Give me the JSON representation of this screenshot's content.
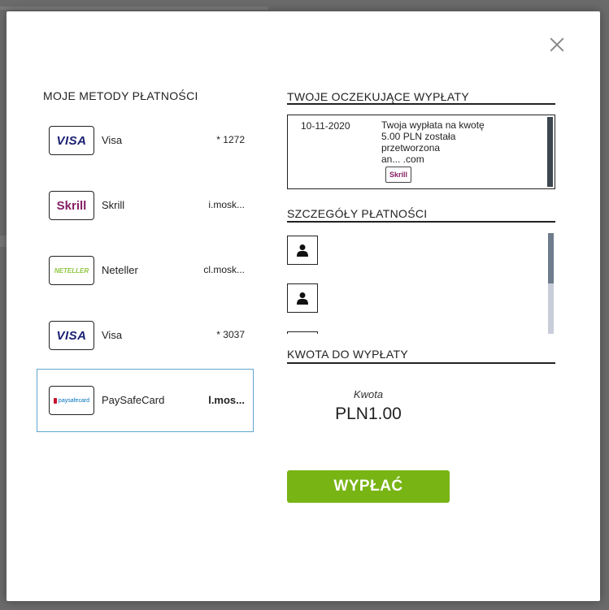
{
  "close": {
    "icon": "close-icon"
  },
  "methods": {
    "title": "MOJE METODY PŁATNOŚCI",
    "items": [
      {
        "name": "Visa",
        "id": "* 1272",
        "logo": "VISA",
        "icon": "visa-logo"
      },
      {
        "name": "Skrill",
        "id": "i.mosk...",
        "logo": "Skrill",
        "icon": "skrill-logo"
      },
      {
        "name": "Neteller",
        "id": "cl.mosk...",
        "logo": "NETELLER",
        "icon": "neteller-logo"
      },
      {
        "name": "Visa",
        "id": "* 3037",
        "logo": "VISA",
        "icon": "visa-logo"
      },
      {
        "name": "PaySafeCard",
        "id": "l.mos...",
        "logo": "paysafecard",
        "icon": "paysafecard-logo",
        "selected": true
      }
    ]
  },
  "pending": {
    "title": "TWOJE OCZEKUJĄCE WYPŁATY",
    "items": [
      {
        "date": "10-11-2020",
        "line1": "Twoja wypłata na kwotę",
        "line2": "5.00 PLN została",
        "line3": "przetworzona",
        "line4": "an...                   .com",
        "logo": "Skrill"
      }
    ]
  },
  "details": {
    "title": "SZCZEGÓŁY PŁATNOŚCI"
  },
  "amount": {
    "title": "KWOTA DO WYPŁATY",
    "label": "Kwota",
    "value": "PLN1.00"
  },
  "actions": {
    "withdraw": "WYPŁAĆ"
  },
  "colors": {
    "accent": "#78b414",
    "selected_border": "#5fa6cf",
    "skrill": "#862165",
    "visa": "#1a1f71",
    "neteller": "#8dc63f"
  }
}
